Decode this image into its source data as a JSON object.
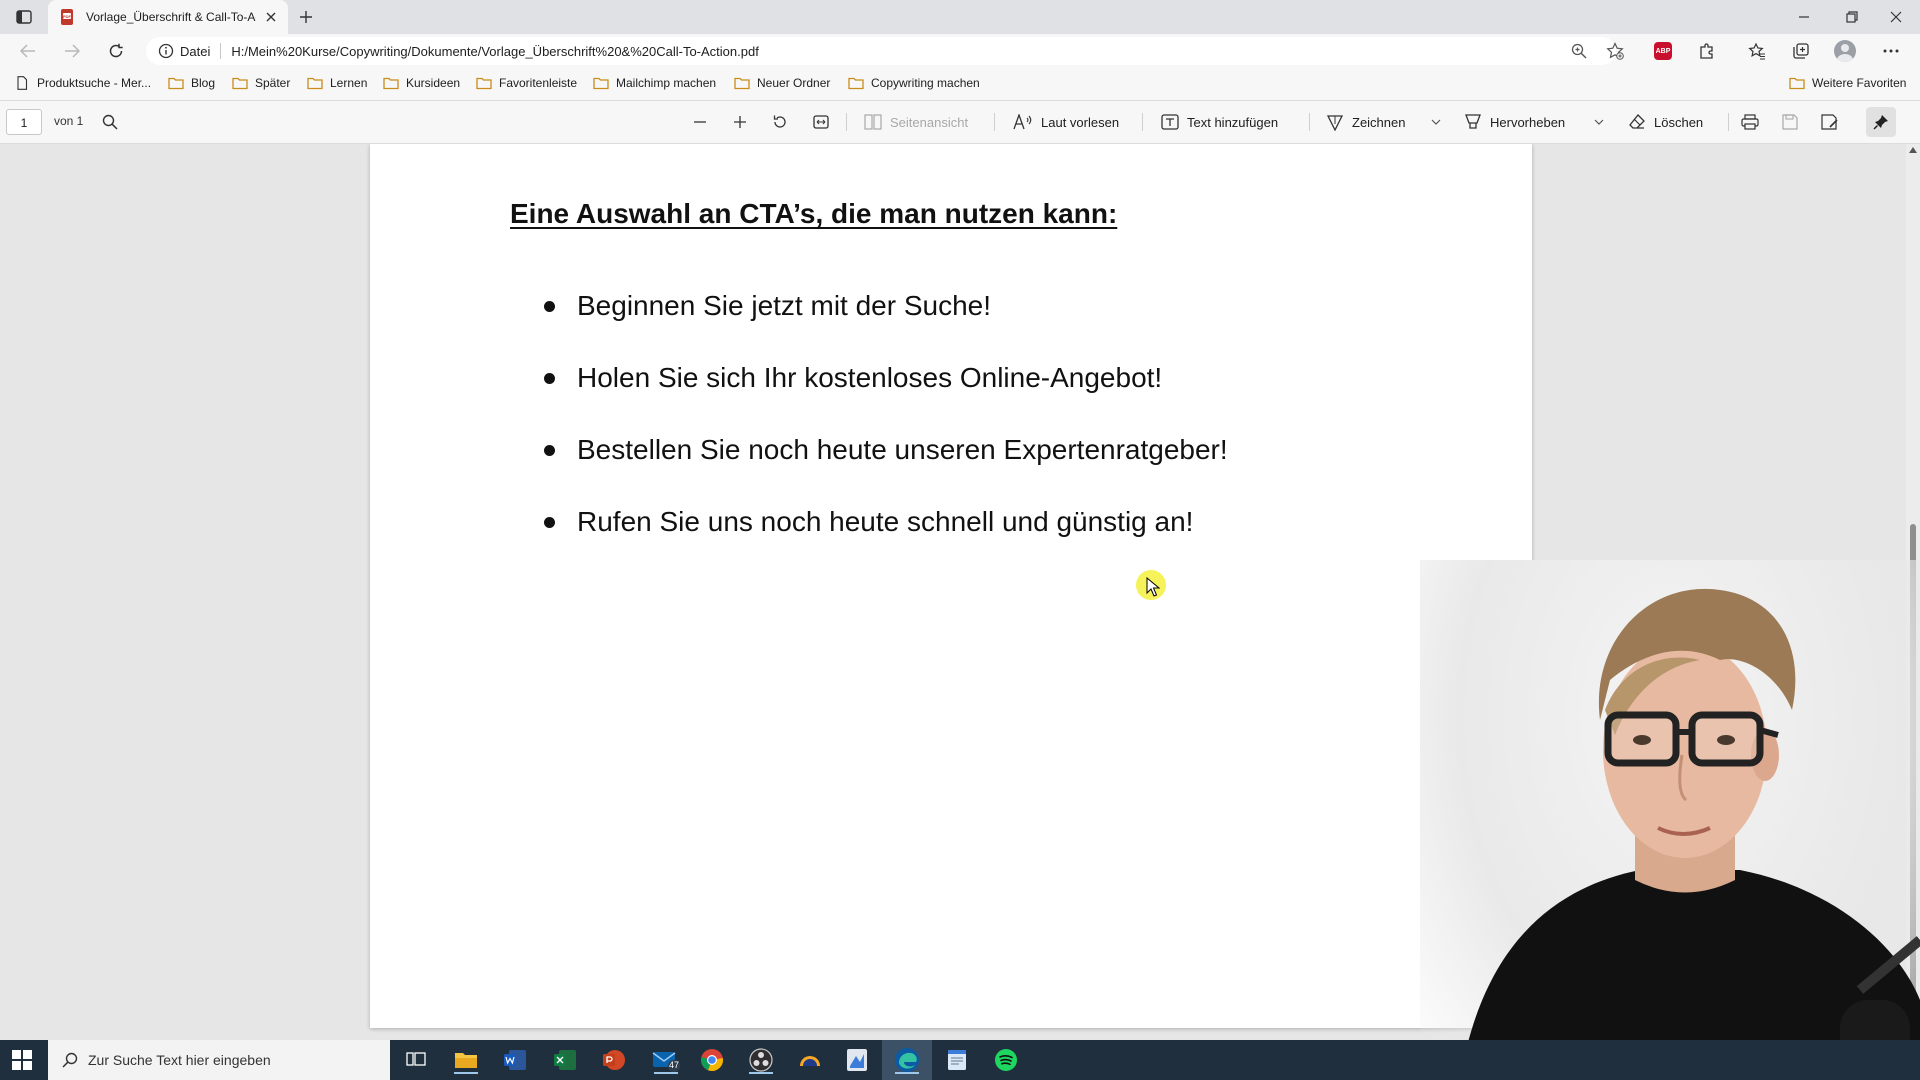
{
  "browser": {
    "tab": {
      "title": "Vorlage_Überschrift & Call-To-Action.pdf"
    },
    "address": {
      "scheme_label": "Datei",
      "url": "H:/Mein%20Kurse/Copywriting/Dokumente/Vorlage_Überschrift%20&%20Call-To-Action.pdf"
    },
    "favorites": [
      {
        "label": "Produktsuche - Mer...",
        "icon": "page-icon"
      },
      {
        "label": "Blog",
        "icon": "folder-icon"
      },
      {
        "label": "Später",
        "icon": "folder-icon"
      },
      {
        "label": "Lernen",
        "icon": "folder-icon"
      },
      {
        "label": "Kursideen",
        "icon": "folder-icon"
      },
      {
        "label": "Favoritenleiste",
        "icon": "folder-icon"
      },
      {
        "label": "Mailchimp machen",
        "icon": "folder-icon"
      },
      {
        "label": "Neuer Ordner",
        "icon": "folder-icon"
      },
      {
        "label": "Copywriting machen",
        "icon": "folder-icon"
      }
    ],
    "other_favorites": "Weitere Favoriten"
  },
  "pdf_toolbar": {
    "page_number": "1",
    "page_total": "von 1",
    "page_view": "Seitenansicht",
    "read_aloud": "Laut vorlesen",
    "add_text": "Text hinzufügen",
    "draw": "Zeichnen",
    "highlight": "Hervorheben",
    "erase": "Löschen"
  },
  "document": {
    "heading": "Eine Auswahl an CTA’s, die man nutzen kann:",
    "items": [
      "Beginnen Sie jetzt mit der Suche!",
      "Holen Sie sich Ihr kostenloses Online-Angebot!",
      "Bestellen Sie noch heute unseren Expertenratgeber!",
      "Rufen Sie uns noch heute schnell und günstig an!"
    ]
  },
  "taskbar": {
    "search_placeholder": "Zur Suche Text hier eingeben",
    "mail_badge": "47"
  },
  "colors": {
    "accent_highlight": "#f5f03c",
    "taskbar_bg": "#1f2f3d",
    "abp_red": "#c8102e"
  }
}
